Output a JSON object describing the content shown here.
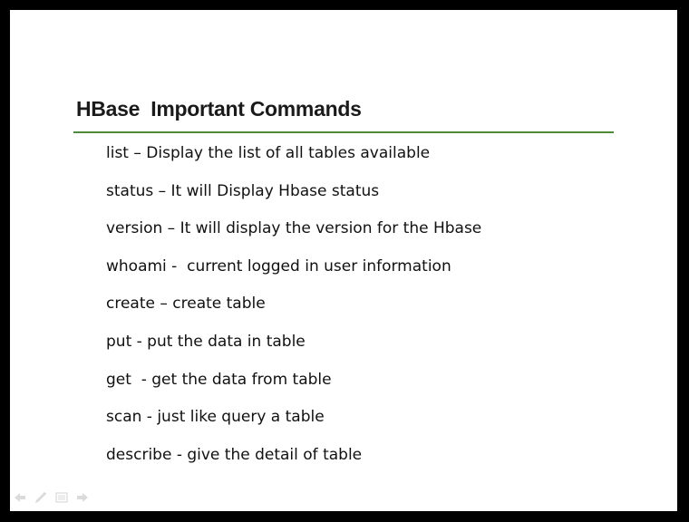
{
  "slide": {
    "title": "HBase  Important Commands",
    "commands": [
      "list – Display the list of all tables available",
      "status – It will Display Hbase status",
      "version – It will display the version for the Hbase",
      "whoami -  current logged in user information",
      "create – create table",
      "put - put the data in table",
      "get  - get the data from table",
      "scan - just like query a table",
      "describe - give the detail of table"
    ]
  },
  "colors": {
    "background": "#000000",
    "slide": "#ffffff",
    "title_rule": "#4f8a3c",
    "text": "#111111"
  },
  "nav_icons": [
    "back-arrow-icon",
    "pen-icon",
    "menu-icon",
    "forward-arrow-icon"
  ]
}
